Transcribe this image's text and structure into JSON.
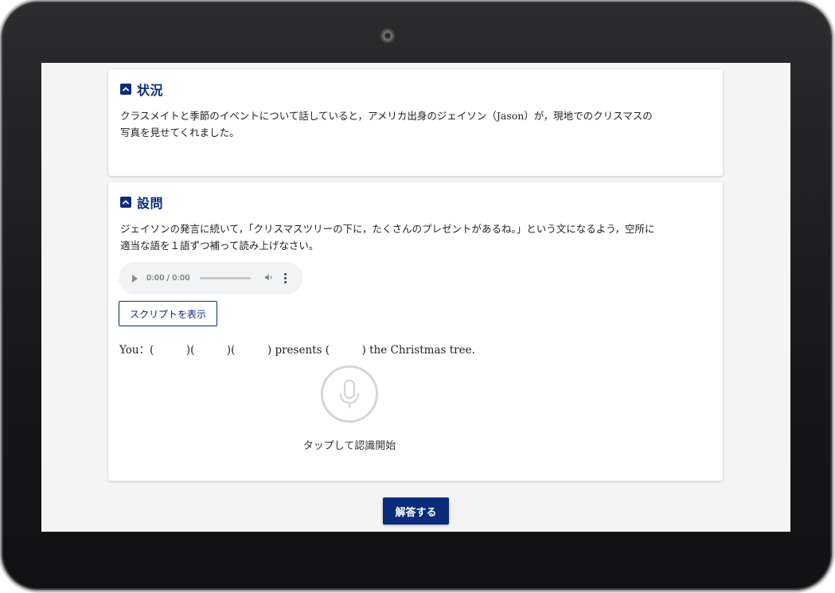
{
  "situation": {
    "title": "状況",
    "text_line1": "クラスメイトと季節のイベントについて話していると，アメリカ出身のジェイソン（Jason）が，現地でのクリスマスの",
    "text_line2": "写真を見せてくれました。"
  },
  "question": {
    "title": "設問",
    "text_line1": "ジェイソンの発言に続いて，「クリスマスツリーの下に，たくさんのプレゼントがあるね。」という文になるよう，空所に",
    "text_line2": "適当な語を１語ずつ補って読み上げなさい。",
    "audio": {
      "time": "0:00 / 0:00"
    },
    "script_button": "スクリプトを表示",
    "sentence": "You：(　　　)(　　　)(　　　) presents (　　　) the Christmas tree.",
    "mic_label": "タップして認識開始"
  },
  "answer_button": "解答する",
  "colors": {
    "accent": "#0b2c7a",
    "screen_bg": "#f4f4f4",
    "device_frame": "#1b1b1d"
  },
  "icons": {
    "collapse": "chevron-up-icon",
    "play": "play-icon",
    "volume": "volume-icon",
    "more": "more-vert-icon",
    "mic": "microphone-icon",
    "camera": "camera-icon"
  }
}
